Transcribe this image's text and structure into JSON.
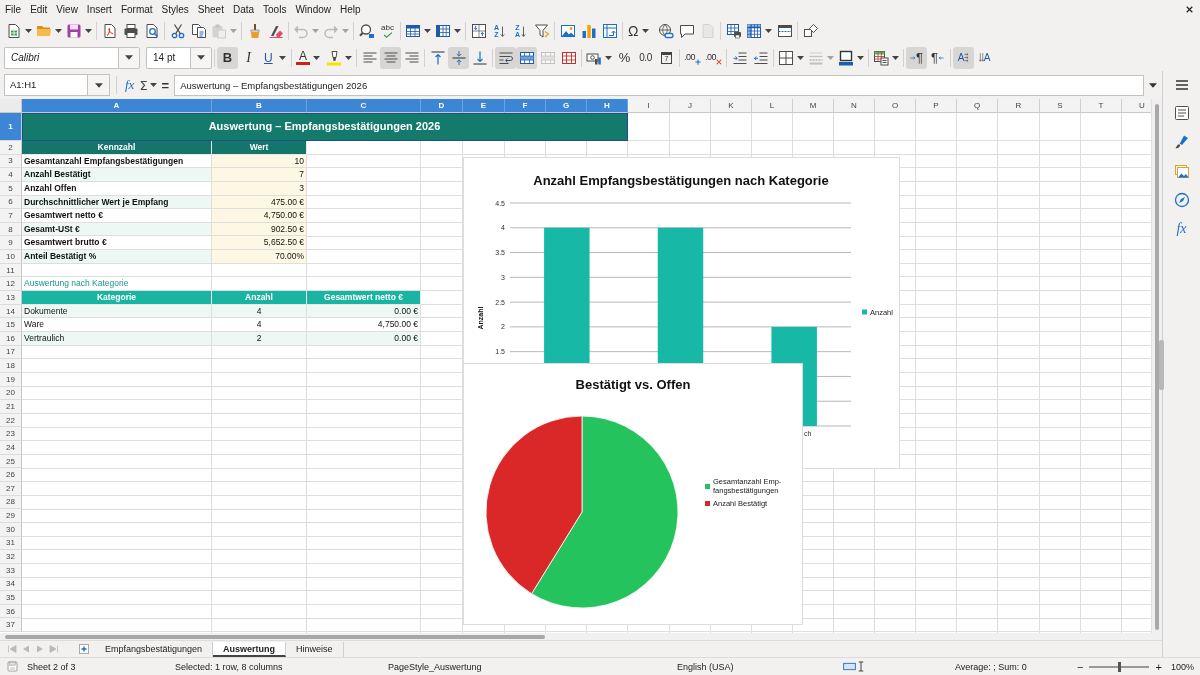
{
  "menu": [
    "File",
    "Edit",
    "View",
    "Insert",
    "Format",
    "Styles",
    "Sheet",
    "Data",
    "Tools",
    "Window",
    "Help"
  ],
  "standard_toolbar": [
    [
      {
        "kind": "new",
        "dropdown": true,
        "disabled": false
      },
      {
        "kind": "open",
        "dropdown": true,
        "disabled": false
      },
      {
        "kind": "save",
        "dropdown": true,
        "disabled": false
      }
    ],
    [
      {
        "kind": "pdf",
        "dropdown": false,
        "disabled": false
      },
      {
        "kind": "print",
        "dropdown": false,
        "disabled": false
      },
      {
        "kind": "preview",
        "dropdown": false,
        "disabled": false
      }
    ],
    [
      {
        "kind": "cut",
        "dropdown": false,
        "disabled": false
      },
      {
        "kind": "copy",
        "dropdown": false,
        "disabled": false
      },
      {
        "kind": "paste",
        "dropdown": true,
        "disabled": true
      }
    ],
    [
      {
        "kind": "clone",
        "dropdown": false,
        "disabled": false
      },
      {
        "kind": "clear",
        "dropdown": false,
        "disabled": false
      }
    ],
    [
      {
        "kind": "undo",
        "dropdown": true,
        "disabled": true
      },
      {
        "kind": "redo",
        "dropdown": true,
        "disabled": true
      }
    ],
    [
      {
        "kind": "find",
        "dropdown": false,
        "disabled": false
      },
      {
        "kind": "spelling",
        "glyph": "abc",
        "dropdown": false,
        "disabled": false
      }
    ],
    [
      {
        "kind": "rows",
        "dropdown": true,
        "disabled": false
      },
      {
        "kind": "columns",
        "dropdown": true,
        "disabled": false
      }
    ],
    [
      {
        "kind": "sort",
        "dropdown": false,
        "disabled": false
      },
      {
        "kind": "sort-ascending",
        "glyph": "AZ",
        "dropdown": false,
        "disabled": false
      },
      {
        "kind": "sort-descending",
        "glyph": "ZA",
        "dropdown": false,
        "disabled": false
      },
      {
        "kind": "autofilter",
        "dropdown": false,
        "disabled": false
      }
    ],
    [
      {
        "kind": "image",
        "dropdown": false,
        "disabled": false
      },
      {
        "kind": "chart",
        "dropdown": false,
        "disabled": false
      },
      {
        "kind": "pivot",
        "dropdown": false,
        "disabled": false
      }
    ],
    [
      {
        "kind": "special-character",
        "glyph": "Ω",
        "dropdown": true,
        "disabled": false
      },
      {
        "kind": "hyperlink",
        "dropdown": false,
        "disabled": false
      },
      {
        "kind": "comment",
        "dropdown": false,
        "disabled": false
      },
      {
        "kind": "header-footer",
        "dropdown": false,
        "disabled": true
      }
    ],
    [
      {
        "kind": "print-area",
        "dropdown": false,
        "disabled": false
      },
      {
        "kind": "freeze",
        "dropdown": true,
        "disabled": false
      },
      {
        "kind": "split",
        "dropdown": false,
        "disabled": false
      }
    ],
    [
      {
        "kind": "draw",
        "dropdown": false,
        "disabled": false
      }
    ]
  ],
  "format_toolbar": {
    "font_name": "Calibri",
    "font_size": "14 pt",
    "groups": [
      [
        {
          "kind": "bold",
          "glyph": "B",
          "pressed": true,
          "dropdown": false,
          "disabled": false
        },
        {
          "kind": "italic",
          "glyph": "I",
          "pressed": false,
          "dropdown": false,
          "disabled": false
        },
        {
          "kind": "underline",
          "glyph": "U",
          "pressed": false,
          "dropdown": true,
          "disabled": false
        }
      ],
      [
        {
          "kind": "font-color",
          "glyph": "A",
          "pressed": false,
          "dropdown": true,
          "disabled": false
        },
        {
          "kind": "highlight",
          "pressed": false,
          "dropdown": true,
          "disabled": false
        }
      ],
      [
        {
          "kind": "align-left",
          "pressed": false,
          "dropdown": false,
          "disabled": false
        },
        {
          "kind": "align-center",
          "pressed": true,
          "dropdown": false,
          "disabled": false
        },
        {
          "kind": "align-right",
          "pressed": false,
          "dropdown": false,
          "disabled": false
        }
      ],
      [
        {
          "kind": "align-top",
          "pressed": false,
          "dropdown": false,
          "disabled": false
        },
        {
          "kind": "align-middle",
          "pressed": true,
          "dropdown": false,
          "disabled": false
        },
        {
          "kind": "align-bottom",
          "pressed": false,
          "dropdown": false,
          "disabled": false
        }
      ],
      [
        {
          "kind": "wrap",
          "pressed": true,
          "dropdown": false,
          "disabled": false
        },
        {
          "kind": "merge-center",
          "pressed": true,
          "dropdown": false,
          "disabled": false
        },
        {
          "kind": "merge",
          "pressed": false,
          "dropdown": false,
          "disabled": true
        },
        {
          "kind": "unmerge",
          "pressed": false,
          "dropdown": false,
          "disabled": false
        }
      ],
      [
        {
          "kind": "currency",
          "pressed": false,
          "dropdown": true,
          "disabled": false
        },
        {
          "kind": "percent",
          "glyph": "%",
          "pressed": false,
          "dropdown": false,
          "disabled": false
        },
        {
          "kind": "number",
          "glyph": "0.0",
          "pressed": false,
          "dropdown": false,
          "disabled": false
        },
        {
          "kind": "date",
          "glyph": "7",
          "pressed": false,
          "dropdown": false,
          "disabled": false
        }
      ],
      [
        {
          "kind": "add-decimal",
          "glyph": ".00",
          "pressed": false,
          "dropdown": false,
          "disabled": false
        },
        {
          "kind": "delete-decimal",
          "glyph": ".00",
          "pressed": false,
          "dropdown": false,
          "disabled": false
        }
      ],
      [
        {
          "kind": "indent",
          "pressed": false,
          "dropdown": false,
          "disabled": false
        },
        {
          "kind": "outdent",
          "pressed": false,
          "dropdown": false,
          "disabled": false
        }
      ],
      [
        {
          "kind": "borders",
          "pressed": false,
          "dropdown": true,
          "disabled": false
        },
        {
          "kind": "border-style",
          "pressed": false,
          "dropdown": true,
          "disabled": true
        },
        {
          "kind": "border-color",
          "pressed": false,
          "dropdown": true,
          "disabled": false
        }
      ],
      [
        {
          "kind": "conditional",
          "pressed": false,
          "dropdown": true,
          "disabled": false
        }
      ],
      [
        {
          "kind": "left-to-right",
          "glyph": "¶",
          "pressed": true,
          "dropdown": false,
          "disabled": false
        },
        {
          "kind": "right-to-left",
          "glyph": "¶",
          "pressed": false,
          "dropdown": false,
          "disabled": false
        }
      ],
      [
        {
          "kind": "text-horizontal",
          "glyph": "A",
          "pressed": true,
          "dropdown": false,
          "disabled": false
        },
        {
          "kind": "text-vertical",
          "glyph": "A",
          "pressed": false,
          "dropdown": false,
          "disabled": false
        }
      ]
    ]
  },
  "formula_bar": {
    "name_box": "A1:H1",
    "function_wizard": "fx",
    "sum": "Σ",
    "equals": "=",
    "formula": "Auswertung – Empfangsbestätigungen 2026"
  },
  "sidebar": [
    {
      "kind": "properties",
      "selected": false
    },
    {
      "kind": "styles",
      "selected": false
    },
    {
      "kind": "gallery",
      "selected": false
    },
    {
      "kind": "navigator",
      "selected": false
    },
    {
      "kind": "functions",
      "glyph": "fx",
      "selected": false
    }
  ],
  "sheet": {
    "columns": [
      {
        "label": "A",
        "selected": true
      },
      {
        "label": "B",
        "selected": true
      },
      {
        "label": "C",
        "selected": true
      },
      {
        "label": "D",
        "selected": true
      },
      {
        "label": "E",
        "selected": true
      },
      {
        "label": "F",
        "selected": true
      },
      {
        "label": "G",
        "selected": true
      },
      {
        "label": "H",
        "selected": true
      },
      {
        "label": "I",
        "selected": false
      },
      {
        "label": "J",
        "selected": false
      },
      {
        "label": "K",
        "selected": false
      },
      {
        "label": "L",
        "selected": false
      },
      {
        "label": "M",
        "selected": false
      },
      {
        "label": "N",
        "selected": false
      },
      {
        "label": "O",
        "selected": false
      },
      {
        "label": "P",
        "selected": false
      },
      {
        "label": "Q",
        "selected": false
      },
      {
        "label": "R",
        "selected": false
      },
      {
        "label": "S",
        "selected": false
      },
      {
        "label": "T",
        "selected": false
      },
      {
        "label": "U",
        "selected": false
      }
    ],
    "rows": [
      {
        "label": "1",
        "selected": true,
        "kind": "title",
        "cells": [
          "Auswertung – Empfangsbestätigungen 2026"
        ]
      },
      {
        "label": "2",
        "selected": false,
        "kind": "header",
        "cells": [
          "Kennzahl",
          "Wert"
        ]
      },
      {
        "label": "3",
        "selected": false,
        "kind": "metric",
        "banded": false,
        "cells": [
          "Gesamtanzahl Empfangsbestätigungen",
          "10"
        ]
      },
      {
        "label": "4",
        "selected": false,
        "kind": "metric",
        "banded": true,
        "cells": [
          "Anzahl Bestätigt",
          "7"
        ]
      },
      {
        "label": "5",
        "selected": false,
        "kind": "metric",
        "banded": false,
        "cells": [
          "Anzahl Offen",
          "3"
        ]
      },
      {
        "label": "6",
        "selected": false,
        "kind": "metric",
        "banded": true,
        "cells": [
          "Durchschnittlicher Wert je Empfang",
          "475.00 €"
        ]
      },
      {
        "label": "7",
        "selected": false,
        "kind": "metric",
        "banded": false,
        "cells": [
          "Gesamtwert netto €",
          "4,750.00 €"
        ]
      },
      {
        "label": "8",
        "selected": false,
        "kind": "metric",
        "banded": true,
        "cells": [
          "Gesamt-USt €",
          "902.50 €"
        ]
      },
      {
        "label": "9",
        "selected": false,
        "kind": "metric",
        "banded": false,
        "cells": [
          "Gesamtwert brutto €",
          "5,652.50 €"
        ]
      },
      {
        "label": "10",
        "selected": false,
        "kind": "metric",
        "banded": true,
        "cells": [
          "Anteil Bestätigt %",
          "70.00%"
        ]
      },
      {
        "label": "11",
        "selected": false,
        "kind": "empty"
      },
      {
        "label": "12",
        "selected": false,
        "kind": "section",
        "cells": [
          "Auswertung nach Kategorie"
        ]
      },
      {
        "label": "13",
        "selected": false,
        "kind": "subheader",
        "cells": [
          "Kategorie",
          "Anzahl",
          "Gesamtwert netto €"
        ]
      },
      {
        "label": "14",
        "selected": false,
        "kind": "category",
        "banded": true,
        "cells": [
          "Dokumente",
          "4",
          "0.00 €"
        ]
      },
      {
        "label": "15",
        "selected": false,
        "kind": "category",
        "banded": false,
        "cells": [
          "Ware",
          "4",
          "4,750.00 €"
        ]
      },
      {
        "label": "16",
        "selected": false,
        "kind": "category",
        "banded": true,
        "cells": [
          "Vertraulich",
          "2",
          "0.00 €"
        ]
      },
      {
        "label": "17",
        "selected": false,
        "kind": "empty"
      },
      {
        "label": "18",
        "selected": false,
        "kind": "empty"
      },
      {
        "label": "19",
        "selected": false,
        "kind": "empty"
      },
      {
        "label": "20",
        "selected": false,
        "kind": "empty"
      },
      {
        "label": "21",
        "selected": false,
        "kind": "empty"
      },
      {
        "label": "22",
        "selected": false,
        "kind": "empty"
      },
      {
        "label": "23",
        "selected": false,
        "kind": "empty"
      },
      {
        "label": "24",
        "selected": false,
        "kind": "empty"
      },
      {
        "label": "25",
        "selected": false,
        "kind": "empty"
      },
      {
        "label": "26",
        "selected": false,
        "kind": "empty"
      },
      {
        "label": "27",
        "selected": false,
        "kind": "empty"
      },
      {
        "label": "28",
        "selected": false,
        "kind": "empty"
      },
      {
        "label": "29",
        "selected": false,
        "kind": "empty"
      },
      {
        "label": "30",
        "selected": false,
        "kind": "empty"
      },
      {
        "label": "31",
        "selected": false,
        "kind": "empty"
      },
      {
        "label": "32",
        "selected": false,
        "kind": "empty"
      },
      {
        "label": "33",
        "selected": false,
        "kind": "empty"
      },
      {
        "label": "34",
        "selected": false,
        "kind": "empty"
      },
      {
        "label": "35",
        "selected": false,
        "kind": "empty"
      },
      {
        "label": "36",
        "selected": false,
        "kind": "empty"
      },
      {
        "label": "37",
        "selected": false,
        "kind": "empty"
      }
    ]
  },
  "bar_chart": {
    "chart_data": {
      "type": "bar",
      "title": "Anzahl Empfangsbestätigungen nach Kategorie",
      "ylabel": "Anzahl",
      "series": [
        {
          "name": "Anzahl",
          "color": "#17b8a6",
          "values": [
            4,
            4,
            2
          ]
        }
      ],
      "ylim": [
        0,
        4.5
      ],
      "yticks": [
        1.5,
        2,
        2.5,
        3,
        3.5,
        4,
        4.5
      ],
      "grid": true,
      "legend": "right"
    },
    "category_label_fragment": "ch"
  },
  "pie_chart": {
    "chart_data": {
      "type": "pie",
      "title": "Bestätigt vs. Offen",
      "categories": [
        "Gesamtanzahl Emp-fangsbestätigungen",
        "Anzahl Bestätigt"
      ],
      "values": [
        58.8,
        41.2
      ],
      "legend": "right"
    },
    "slices": [
      {
        "color": "#24c35e"
      },
      {
        "color": "#da2828"
      }
    ]
  },
  "tab_bar": {
    "scroll_buttons_disabled": true,
    "tabs": [
      {
        "label": "Empfangsbestätigungen",
        "selected": false
      },
      {
        "label": "Auswertung",
        "selected": true
      },
      {
        "label": "Hinweise",
        "selected": false
      }
    ]
  },
  "status_bar": {
    "sheet": "Sheet 2 of 3",
    "selection": "Selected: 1 row, 8 columns",
    "page_style": "PageStyle_Auswertung",
    "language": "English (USA)",
    "summary": "Average: ; Sum: 0",
    "zoom_out": "−",
    "zoom_slider": {
      "level": 0.5
    },
    "zoom_in": "+",
    "zoom": "100%"
  }
}
